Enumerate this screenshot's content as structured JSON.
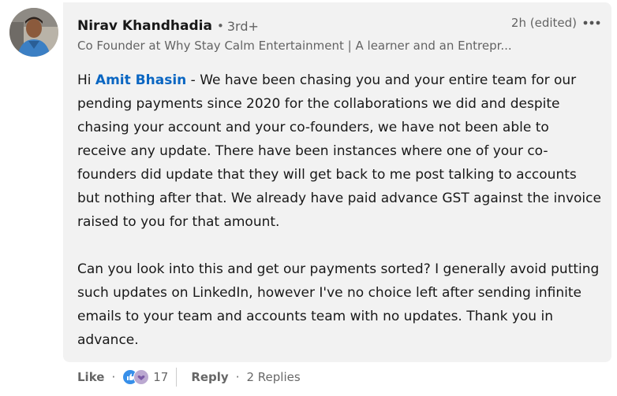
{
  "author": {
    "name": "Nirav Khandhadia",
    "degree_sep": "•",
    "degree": "3rd+",
    "headline": "Co Founder at Why Stay Calm Entertainment | A learner and an Entrepr..."
  },
  "meta": {
    "timestamp": "2h (edited)",
    "more_icon": "ellipsis-icon"
  },
  "comment": {
    "greeting": "Hi ",
    "mention": "Amit Bhasin",
    "paragraph_1_rest": " - We have been chasing you and your entire team for our pending payments since 2020 for the collaborations we did and despite chasing your account and your co-founders, we have not been able to receive any update. There have been instances where one of your co-founders did update that they will get back to me post talking to accounts but nothing after that. We already have paid advance GST against the invoice raised to you for that amount.",
    "paragraph_2": "Can you look into this and get our payments sorted? I generally avoid putting such updates on LinkedIn, however I've no choice left after sending infinite emails to your team and accounts team with no updates. Thank you in advance."
  },
  "actions": {
    "like_label": "Like",
    "separator": "·",
    "reaction_icons": [
      "like-reaction-icon",
      "support-reaction-icon"
    ],
    "reaction_count": "17",
    "reply_label": "Reply",
    "replies_label": "2 Replies"
  },
  "colors": {
    "mention": "#0a66c2",
    "bubble_bg": "#f2f2f2",
    "like_reaction": "#378fe9",
    "support_reaction": "#bba9d1"
  }
}
